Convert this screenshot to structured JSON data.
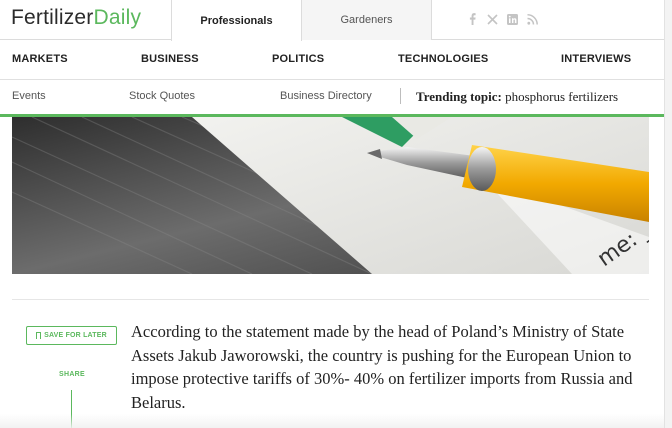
{
  "logo": {
    "part1": "Fertilizer",
    "part2": "Daily"
  },
  "audience_tabs": [
    {
      "label": "Professionals",
      "active": true
    },
    {
      "label": "Gardeners",
      "active": false
    }
  ],
  "social_icons": [
    "facebook-icon",
    "x-icon",
    "linkedin-icon",
    "rss-icon"
  ],
  "main_nav": [
    "MARKETS",
    "BUSINESS",
    "POLITICS",
    "TECHNOLOGIES",
    "INTERVIEWS"
  ],
  "sub_nav": [
    "Events",
    "Stock Quotes",
    "Business Directory"
  ],
  "trending": {
    "label": "Trending topic:",
    "topic": "phosphorus fertilizers"
  },
  "article": {
    "save_label": "SAVE FOR LATER",
    "share_label": "SHARE",
    "lead": "According to the statement made by the head of Poland’s Ministry of State Assets Jakub Jaworowski, the country is pushing for the European Union to impose protective tariffs of 30%- 40% on fertilizer imports from Russia and Belarus."
  },
  "hero_image": {
    "text_fragment": "me: _"
  },
  "colors": {
    "accent": "#5bb85d",
    "text": "#222222"
  }
}
